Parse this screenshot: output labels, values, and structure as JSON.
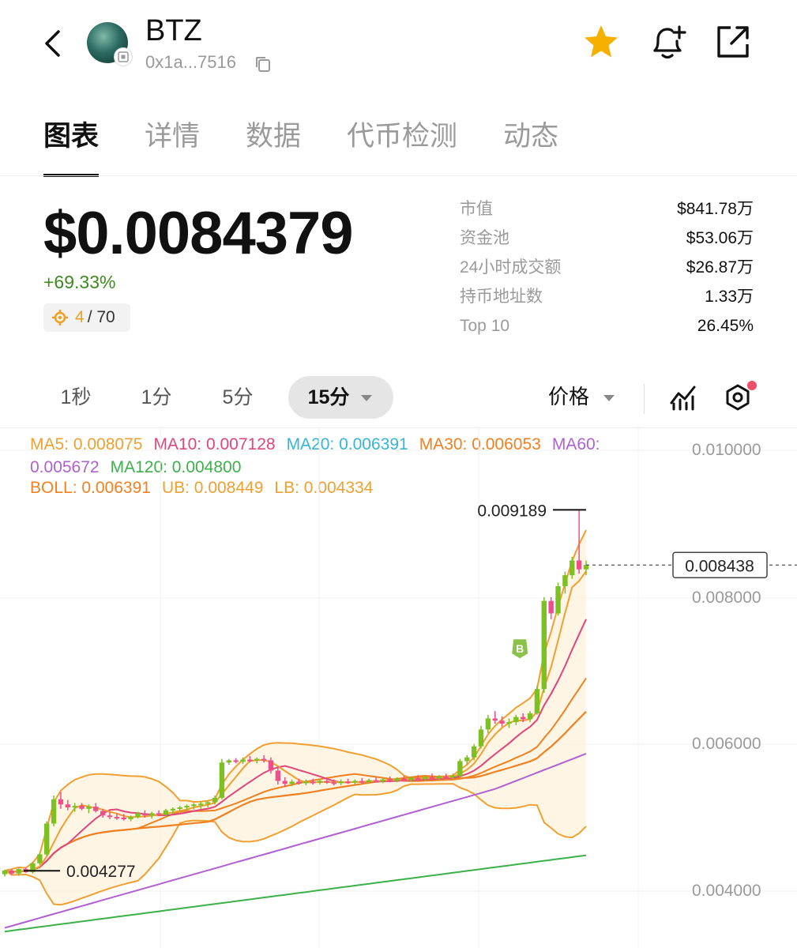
{
  "header": {
    "token_name": "BTZ",
    "address": "0x1a...7516",
    "icons": [
      "back-chevron-icon",
      "star-icon",
      "bell-plus-icon",
      "share-external-icon",
      "copy-icon"
    ],
    "star_color": "#f5b000"
  },
  "tabs": [
    {
      "label": "图表",
      "active": true
    },
    {
      "label": "详情",
      "active": false
    },
    {
      "label": "数据",
      "active": false
    },
    {
      "label": "代币检测",
      "active": false
    },
    {
      "label": "动态",
      "active": false
    }
  ],
  "price": {
    "value": "$0.0084379",
    "change": "+69.33%",
    "change_color": "#3d8a20",
    "rank_current": "4",
    "rank_total": "/ 70"
  },
  "stats": [
    {
      "label": "市值",
      "value": "$841.78万"
    },
    {
      "label": "资金池",
      "value": "$53.06万"
    },
    {
      "label": "24小时成交额",
      "value": "$26.87万"
    },
    {
      "label": "持币地址数",
      "value": "1.33万"
    },
    {
      "label": "Top 10",
      "value": "26.45%"
    }
  ],
  "intervals": [
    {
      "label": "1秒",
      "active": false
    },
    {
      "label": "1分",
      "active": false
    },
    {
      "label": "5分",
      "active": false
    },
    {
      "label": "15分",
      "active": true
    }
  ],
  "price_type": "价格",
  "indicators": {
    "line1": [
      {
        "text": "MA5: 0.008075",
        "color": "#f0a030"
      },
      {
        "text": "MA10: 0.007128",
        "color": "#e0457b"
      },
      {
        "text": "MA20: 0.006391",
        "color": "#36b5d8"
      },
      {
        "text": "MA30: 0.006053",
        "color": "#f08020"
      },
      {
        "text": "MA60:",
        "color": "#b060d0"
      }
    ],
    "line2": [
      {
        "text": "0.005672",
        "color": "#b060d0"
      },
      {
        "text": "MA120: 0.004800",
        "color": "#3cb04a"
      }
    ],
    "line3": [
      {
        "text": "BOLL: 0.006391",
        "color": "#f08020"
      },
      {
        "text": "UB: 0.008449",
        "color": "#f0a030"
      },
      {
        "text": "LB: 0.004334",
        "color": "#f0a030"
      }
    ]
  },
  "chart_data": {
    "type": "candlestick",
    "interval": "15分",
    "y_axis_labels": [
      "0.010000",
      "0.008000",
      "0.006000",
      "0.004000"
    ],
    "ylim": [
      0.00355,
      0.0104
    ],
    "high_marker": "0.009189",
    "low_marker": "0.004277",
    "current_price_label": "0.008438",
    "current_price": 0.008438,
    "trade_marker": "B",
    "up_color": "#7cc021",
    "down_color": "#ee4f8a",
    "candles": [
      [
        0.00423,
        0.00429,
        0.0042,
        0.00428
      ],
      [
        0.00428,
        0.0043,
        0.00422,
        0.00424
      ],
      [
        0.00424,
        0.00431,
        0.00421,
        0.0043
      ],
      [
        0.0043,
        0.00432,
        0.00425,
        0.00426
      ],
      [
        0.00426,
        0.0044,
        0.00424,
        0.00438
      ],
      [
        0.00438,
        0.00452,
        0.00436,
        0.0045
      ],
      [
        0.0045,
        0.00495,
        0.00448,
        0.00492
      ],
      [
        0.00492,
        0.0053,
        0.00488,
        0.00525
      ],
      [
        0.00525,
        0.00535,
        0.00512,
        0.00518
      ],
      [
        0.00518,
        0.00524,
        0.0051,
        0.00514
      ],
      [
        0.00514,
        0.0052,
        0.00508,
        0.00516
      ],
      [
        0.00516,
        0.0052,
        0.0051,
        0.00512
      ],
      [
        0.00512,
        0.00518,
        0.00506,
        0.00515
      ],
      [
        0.00515,
        0.0052,
        0.00507,
        0.00509
      ],
      [
        0.00509,
        0.00512,
        0.005,
        0.00503
      ],
      [
        0.00503,
        0.00508,
        0.00498,
        0.00501
      ],
      [
        0.00501,
        0.00506,
        0.00497,
        0.005
      ],
      [
        0.005,
        0.00505,
        0.00496,
        0.00498
      ],
      [
        0.00498,
        0.00503,
        0.00495,
        0.00501
      ],
      [
        0.00501,
        0.00508,
        0.00499,
        0.00506
      ],
      [
        0.00506,
        0.0051,
        0.005,
        0.00503
      ],
      [
        0.00503,
        0.00508,
        0.00499,
        0.00506
      ],
      [
        0.00506,
        0.0051,
        0.00502,
        0.00504
      ],
      [
        0.00504,
        0.00512,
        0.00502,
        0.0051
      ],
      [
        0.0051,
        0.00514,
        0.00505,
        0.00512
      ],
      [
        0.00512,
        0.00516,
        0.00508,
        0.00514
      ],
      [
        0.00514,
        0.00518,
        0.0051,
        0.00516
      ],
      [
        0.00516,
        0.0052,
        0.00511,
        0.00518
      ],
      [
        0.00518,
        0.00522,
        0.00512,
        0.00519
      ],
      [
        0.00519,
        0.00523,
        0.00514,
        0.00521
      ],
      [
        0.00521,
        0.0053,
        0.00518,
        0.00527
      ],
      [
        0.00527,
        0.0058,
        0.00525,
        0.00575
      ],
      [
        0.00575,
        0.0058,
        0.00572,
        0.00578
      ],
      [
        0.00578,
        0.00581,
        0.00574,
        0.00576
      ],
      [
        0.00576,
        0.00582,
        0.00573,
        0.00579
      ],
      [
        0.00579,
        0.00584,
        0.00575,
        0.00578
      ],
      [
        0.00578,
        0.00582,
        0.00574,
        0.0058
      ],
      [
        0.0058,
        0.00585,
        0.00575,
        0.00578
      ],
      [
        0.00578,
        0.00582,
        0.0056,
        0.00564
      ],
      [
        0.00564,
        0.0057,
        0.00545,
        0.0055
      ],
      [
        0.0055,
        0.00555,
        0.00542,
        0.00546
      ],
      [
        0.00546,
        0.00552,
        0.00543,
        0.00549
      ],
      [
        0.00549,
        0.00553,
        0.00545,
        0.00547
      ],
      [
        0.00547,
        0.00552,
        0.00544,
        0.00549
      ],
      [
        0.00549,
        0.00553,
        0.00545,
        0.00548
      ],
      [
        0.00548,
        0.00553,
        0.00545,
        0.0055
      ],
      [
        0.0055,
        0.00554,
        0.00546,
        0.00548
      ],
      [
        0.00548,
        0.00552,
        0.00544,
        0.00547
      ],
      [
        0.00547,
        0.00552,
        0.00544,
        0.00549
      ],
      [
        0.00549,
        0.00553,
        0.00546,
        0.00548
      ],
      [
        0.00548,
        0.00552,
        0.00545,
        0.0055
      ],
      [
        0.0055,
        0.00554,
        0.00546,
        0.00549
      ],
      [
        0.00549,
        0.00553,
        0.00546,
        0.00551
      ],
      [
        0.00551,
        0.00555,
        0.00548,
        0.0055
      ],
      [
        0.0055,
        0.00554,
        0.00547,
        0.00552
      ],
      [
        0.00552,
        0.00556,
        0.00548,
        0.00551
      ],
      [
        0.00551,
        0.00555,
        0.00548,
        0.00553
      ],
      [
        0.00553,
        0.00557,
        0.00549,
        0.00552
      ],
      [
        0.00552,
        0.00556,
        0.00549,
        0.00554
      ],
      [
        0.00554,
        0.00558,
        0.0055,
        0.00553
      ],
      [
        0.00553,
        0.00557,
        0.0055,
        0.00555
      ],
      [
        0.00555,
        0.0056,
        0.00552,
        0.00554
      ],
      [
        0.00554,
        0.00558,
        0.00551,
        0.00556
      ],
      [
        0.00556,
        0.0056,
        0.00553,
        0.00555
      ],
      [
        0.00555,
        0.0056,
        0.00552,
        0.00557
      ],
      [
        0.00557,
        0.0058,
        0.00555,
        0.00577
      ],
      [
        0.00577,
        0.00585,
        0.00572,
        0.00582
      ],
      [
        0.00582,
        0.006,
        0.00578,
        0.00597
      ],
      [
        0.00597,
        0.00625,
        0.00594,
        0.0062
      ],
      [
        0.0062,
        0.0064,
        0.00615,
        0.00635
      ],
      [
        0.00635,
        0.00645,
        0.00628,
        0.00632
      ],
      [
        0.00632,
        0.00638,
        0.00624,
        0.00628
      ],
      [
        0.00628,
        0.00635,
        0.00622,
        0.0063
      ],
      [
        0.0063,
        0.0064,
        0.00626,
        0.00637
      ],
      [
        0.00637,
        0.00642,
        0.0063,
        0.00634
      ],
      [
        0.00634,
        0.00645,
        0.0063,
        0.00642
      ],
      [
        0.00642,
        0.0068,
        0.0064,
        0.00675
      ],
      [
        0.00675,
        0.008,
        0.0067,
        0.00795
      ],
      [
        0.00795,
        0.008,
        0.0077,
        0.00778
      ],
      [
        0.00778,
        0.0082,
        0.00775,
        0.00815
      ],
      [
        0.00815,
        0.00835,
        0.00805,
        0.0083
      ],
      [
        0.0083,
        0.00855,
        0.00825,
        0.0085
      ],
      [
        0.0085,
        0.00919,
        0.00832,
        0.00838
      ],
      [
        0.00838,
        0.0085,
        0.0083,
        0.00844
      ]
    ]
  }
}
